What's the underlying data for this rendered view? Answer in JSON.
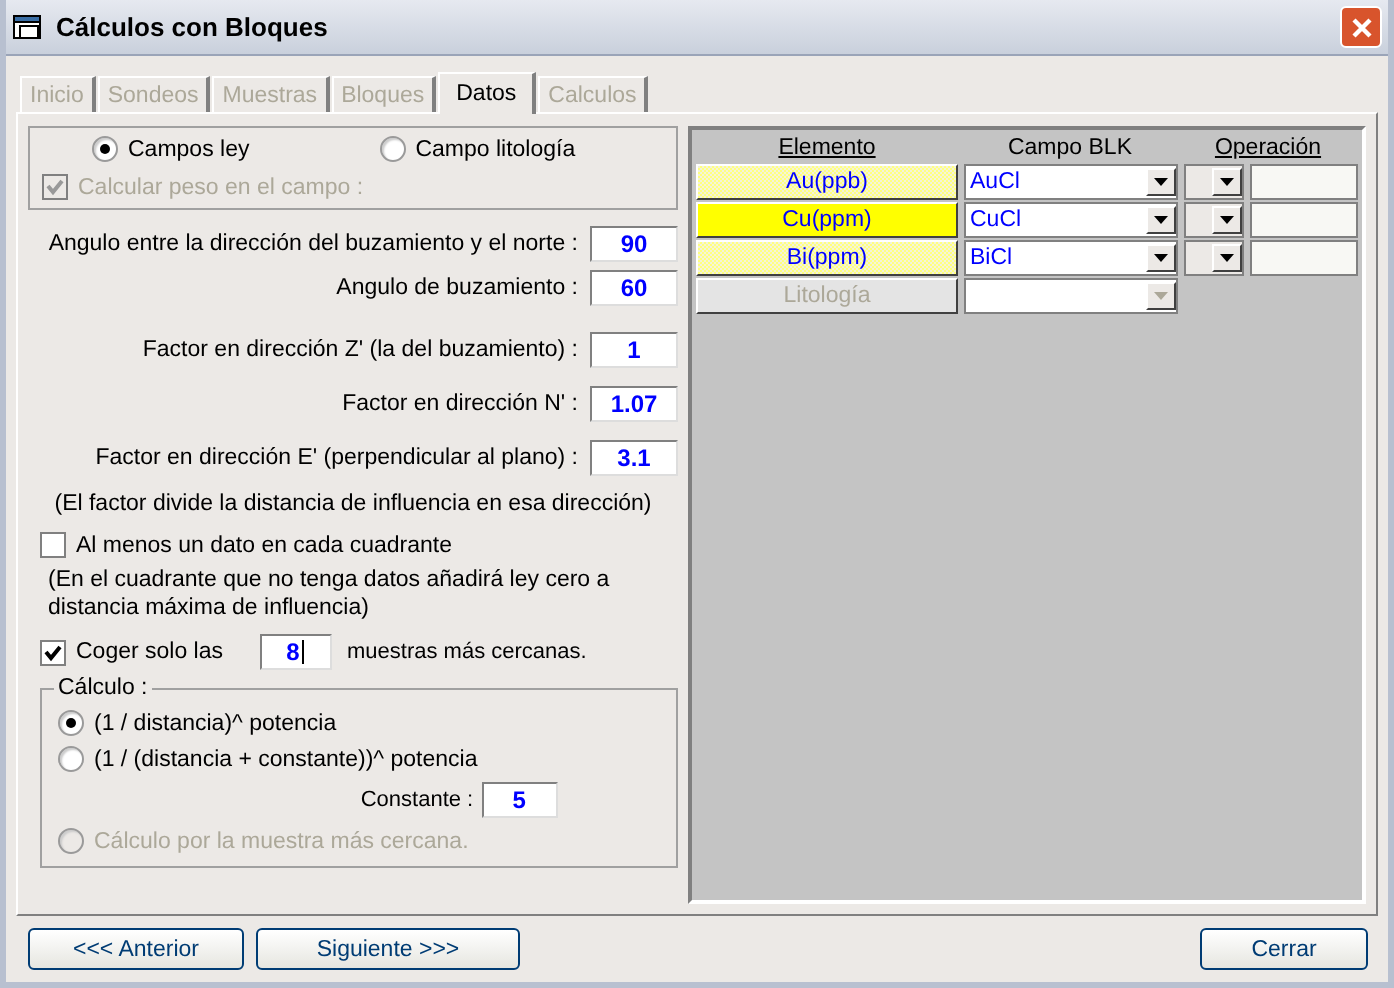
{
  "window": {
    "title": "Cálculos con Bloques"
  },
  "tabs": [
    {
      "label": "Inicio",
      "selected": false,
      "disabled": true
    },
    {
      "label": "Sondeos",
      "selected": false,
      "disabled": true
    },
    {
      "label": "Muestras",
      "selected": false,
      "disabled": true
    },
    {
      "label": "Bloques",
      "selected": false,
      "disabled": true
    },
    {
      "label": "Datos",
      "selected": true,
      "disabled": false
    },
    {
      "label": "Calculos",
      "selected": false,
      "disabled": true
    }
  ],
  "mode": {
    "options": [
      {
        "label": "Campos ley",
        "selected": true
      },
      {
        "label": "Campo litología",
        "selected": false
      }
    ],
    "weight_checkbox": {
      "label": "Calcular peso en el campo :",
      "checked": true,
      "disabled": true
    }
  },
  "params_a": [
    {
      "label": "Angulo entre la dirección del buzamiento y el norte :",
      "value": "90"
    },
    {
      "label": "Angulo de buzamiento :",
      "value": "60"
    }
  ],
  "params_b": [
    {
      "label": "Factor en dirección Z' (la del buzamiento) :",
      "value": "1"
    },
    {
      "label": "Factor en dirección N'  :",
      "value": "1.07"
    },
    {
      "label": "Factor en dirección E' (perpendicular al plano) :",
      "value": "3.1"
    }
  ],
  "factor_note": "(El factor divide la distancia de influencia en esa dirección)",
  "quadrant": {
    "label": "Al menos un dato en cada cuadrante",
    "checked": false
  },
  "quadrant_note": "(En el cuadrante que no tenga datos añadirá ley cero a distancia máxima de influencia)",
  "closest": {
    "label_before": "Coger solo las",
    "value": "8",
    "label_after": "muestras más cercanas.",
    "checked": true
  },
  "calculo": {
    "title": "Cálculo :",
    "options": [
      {
        "label": "(1 / distancia)^ potencia",
        "selected": true,
        "disabled": false
      },
      {
        "label": "(1 / (distancia + constante))^ potencia",
        "selected": false,
        "disabled": false
      },
      {
        "label": "Cálculo por la muestra más cercana.",
        "selected": false,
        "disabled": true
      }
    ],
    "constant": {
      "label": "Constante :",
      "value": "5"
    }
  },
  "grid": {
    "columns": [
      {
        "label": "Elemento",
        "underlined": true
      },
      {
        "label": "Campo BLK",
        "underlined": false
      },
      {
        "label": "Operación",
        "underlined": true
      }
    ],
    "rows": [
      {
        "element": "Au(ppb)",
        "selected": false,
        "disabled": false,
        "field": "AuCl"
      },
      {
        "element": "Cu(ppm)",
        "selected": true,
        "disabled": false,
        "field": "CuCl"
      },
      {
        "element": "Bi(ppm)",
        "selected": false,
        "disabled": false,
        "field": "BiCl"
      },
      {
        "element": "Litología",
        "selected": false,
        "disabled": true
      }
    ]
  },
  "buttons": {
    "back": "<<<  Anterior",
    "next": "Siguiente  >>>",
    "close": "Cerrar"
  }
}
